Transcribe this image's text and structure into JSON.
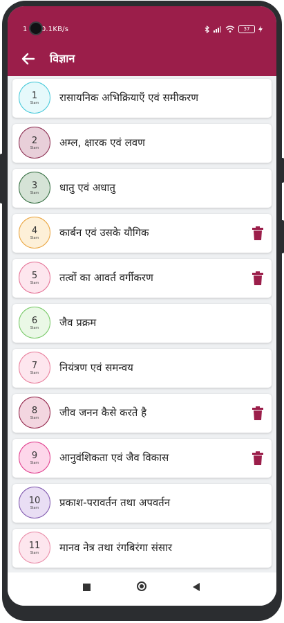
{
  "status": {
    "left_text": "1   7 | 0.1KB/s",
    "battery": "37"
  },
  "app": {
    "title": "विज्ञान",
    "accent": "#9b1e4a"
  },
  "chapters": [
    {
      "number": "1",
      "sub": "Slam",
      "label": "रासायनिक अभिक्रियाएँ एवं समीकरण",
      "circle_bg": "#e6f9fb",
      "circle_border": "#40c7d8",
      "deletable": false
    },
    {
      "number": "2",
      "sub": "Slam",
      "label": "अम्ल, क्षारक एवं लवण",
      "circle_bg": "#e8cfd9",
      "circle_border": "#8a2b4f",
      "deletable": false
    },
    {
      "number": "3",
      "sub": "Slam",
      "label": "धातु एवं अधातु",
      "circle_bg": "#d5e3d6",
      "circle_border": "#2f6a3c",
      "deletable": false
    },
    {
      "number": "4",
      "sub": "Slam",
      "label": "कार्बन एवं उसके यौगिक",
      "circle_bg": "#fdf0d8",
      "circle_border": "#e9a23a",
      "deletable": true
    },
    {
      "number": "5",
      "sub": "Slam",
      "label": "तत्वों का आवर्त वर्गीकरण",
      "circle_bg": "#fde6ee",
      "circle_border": "#e46d92",
      "deletable": true
    },
    {
      "number": "6",
      "sub": "Slam",
      "label": "जैव प्रक्रम",
      "circle_bg": "#eaf8e6",
      "circle_border": "#74c763",
      "deletable": false
    },
    {
      "number": "7",
      "sub": "Slam",
      "label": "नियंत्रण एवं समन्वय",
      "circle_bg": "#fde6ee",
      "circle_border": "#e87b99",
      "deletable": false
    },
    {
      "number": "8",
      "sub": "Slam",
      "label": "जीव जनन कैसे करते है",
      "circle_bg": "#f3d6e0",
      "circle_border": "#8f1f45",
      "deletable": true
    },
    {
      "number": "9",
      "sub": "Slam",
      "label": "आनुवंशिकता एवं जैव विकास",
      "circle_bg": "#fdd7ea",
      "circle_border": "#e0388a",
      "deletable": true
    },
    {
      "number": "10",
      "sub": "Slam",
      "label": "प्रकाश-परावर्तन तथा अपवर्तन",
      "circle_bg": "#e9def4",
      "circle_border": "#7d55ad",
      "deletable": false
    },
    {
      "number": "11",
      "sub": "Slam",
      "label": "मानव नेत्र तथा रंगबिरंगा संसार",
      "circle_bg": "#fde6ee",
      "circle_border": "#e98aa6",
      "deletable": false
    }
  ]
}
